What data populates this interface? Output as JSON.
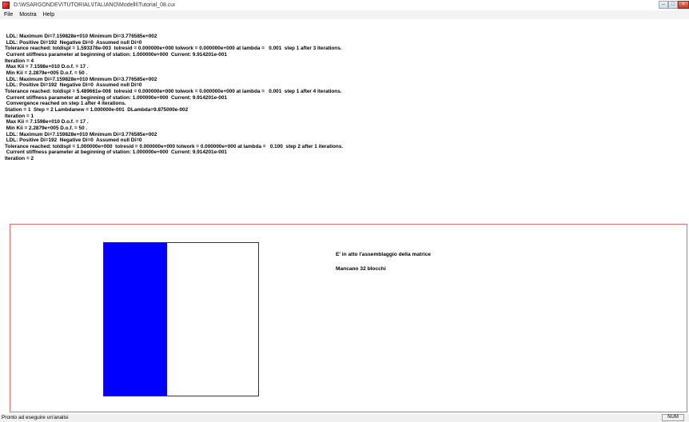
{
  "window": {
    "title": "D:\\WSARGONDEV\\TUTORIAL\\ITALIANO\\Modelli\\Tutorial_08.cui",
    "icon": "app-icon",
    "caption_buttons": [
      "minimize-icon",
      "maximize-icon",
      "close-icon"
    ]
  },
  "menu": {
    "file": "File",
    "mostra": "Mostra",
    "help": "Help"
  },
  "log": {
    "lines": [
      " LDL: Maximum Di=7.159828e+010 Minimum Di=3.776585e+002",
      " LDL: Positive Di=192  Negative Di=0  Assumed null Di=0",
      "Tolerance reached: toldispl = 1.593378e-003  tolresid = 0.000000e+000 tolwork = 0.000000e+000 at lambda =   0.001  step 1 after 3 iterations.",
      " Current stiffness parameter at beginning of station: 1.000000e+000  Current: 9.914201e-001",
      "Iteration = 4",
      " Max Kii = 7.1598e+010 D.o.f. = 17 .",
      " Min Kii = 2.2879e+005 D.o.f. = 50 .",
      " LDL: Maximum Di=7.159828e+010 Minimum Di=3.776585e+002",
      " LDL: Positive Di=192  Negative Di=0  Assumed null Di=0",
      "Tolerance reached: toldispl = 5.489661e-008  tolresid = 0.000000e+000 tolwork = 0.000000e+000 at lambda =   0.001  step 1 after 4 iterations.",
      " Current stiffness parameter at beginning of station: 1.000000e+000  Current: 9.914201e-001",
      " Convergence reached on step 1 after 4 iterations.",
      "Station = 1  Step = 2 Lambdanew = 1.000000e-001  DLambda=9.875000e-002",
      "Iteration = 1",
      " Max Kii = 7.1598e+010 D.o.f. = 17 .",
      " Min Kii = 2.2879e+005 D.o.f. = 50 .",
      " LDL: Maximum Di=7.159828e+010 Minimum Di=3.776585e+002",
      " LDL: Positive Di=192  Negative Di=0  Assumed null Di=0",
      "Tolerance reached: toldispl = 1.000000e+000  tolresid = 0.000000e+000 tolwork = 0.000000e+000 at lambda =   0.100  step 2 after 1 iterations.",
      " Current stiffness parameter at beginning of station: 1.000000e+000  Current: 9.914201e-001",
      "Iteration = 2"
    ]
  },
  "panel": {
    "message_1": "E' in atto l'assemblaggio della matrice",
    "message_2": "Mancano 32 blocchi",
    "progress_fraction": 0.41,
    "progress_color": "#0000ff",
    "frame_color": "#1a1aff",
    "border_color": "#e26b6b"
  },
  "status": {
    "text": "Pronto ad eseguire un'analisi",
    "indicator": "NUM"
  }
}
